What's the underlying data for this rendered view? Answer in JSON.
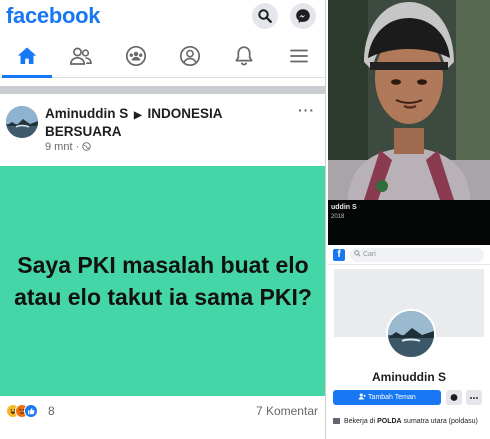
{
  "facebook_app": {
    "logo": "facebook",
    "brand_color": "#1877f2",
    "header_icons": [
      "search-icon",
      "messenger-icon"
    ],
    "nav_tabs": [
      {
        "name": "home",
        "icon": "home-icon",
        "active": true
      },
      {
        "name": "friends",
        "icon": "friends-icon",
        "active": false
      },
      {
        "name": "groups",
        "icon": "groups-icon",
        "active": false
      },
      {
        "name": "profile",
        "icon": "profile-icon",
        "active": false
      },
      {
        "name": "notifications",
        "icon": "bell-icon",
        "active": false
      },
      {
        "name": "menu",
        "icon": "menu-icon",
        "active": false
      }
    ]
  },
  "post": {
    "author": "Aminuddin S",
    "separator": "▶",
    "group": "INDONESIA BERSUARA",
    "time": "9 mnt ·",
    "more": "···",
    "text": "Saya PKI masalah buat elo atau elo takut ia sama PKI?",
    "background_color": "#45d6a8",
    "reaction_count": "8",
    "comments": "7 Komentar"
  },
  "photo": {
    "name": "uddin S",
    "year": "2018"
  },
  "profile": {
    "search_placeholder": "Cari",
    "name": "Aminuddin S",
    "add_friend": "Tambah Teman",
    "work_prefix": "Bekerja di",
    "work_place": "POLDA",
    "work_rest": "sumatra utara (poldasu)"
  }
}
